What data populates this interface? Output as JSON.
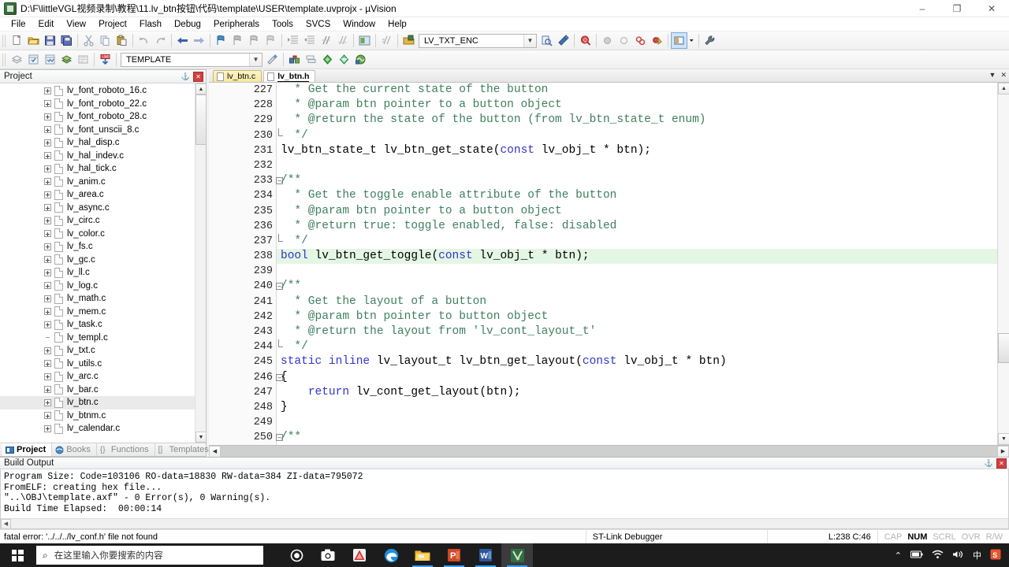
{
  "window": {
    "title": "D:\\F\\littleVGL视频录制\\教程\\11.lv_btn按钮\\代码\\template\\USER\\template.uvprojx - µVision",
    "app_icon": "uvision-icon",
    "minimize": "–",
    "maximize": "❐",
    "close": "✕"
  },
  "menu": [
    "File",
    "Edit",
    "View",
    "Project",
    "Flash",
    "Debug",
    "Peripherals",
    "Tools",
    "SVCS",
    "Window",
    "Help"
  ],
  "toolbar_row1_icons": [
    "new-file-icon",
    "open-file-icon",
    "save-icon",
    "save-all-icon",
    "cut-icon",
    "copy-icon",
    "paste-icon",
    "undo-icon",
    "redo-icon",
    "navigate-back-icon",
    "navigate-forward-icon",
    "bookmark-toggle-icon",
    "bookmark-prev-icon",
    "bookmark-next-icon",
    "bookmark-clear-icon",
    "indent-icon",
    "outdent-icon",
    "comment-icon",
    "uncomment-icon",
    "build-target-icon"
  ],
  "toolbar_row2": {
    "icons_left": [
      "translate-icon",
      "build-icon",
      "rebuild-icon",
      "batch-build-icon",
      "stop-build-icon",
      "download-icon"
    ],
    "target_value": "TEMPLATE",
    "target_placeholder": "TEMPLATE",
    "icons_after_target": [
      "target-options-icon",
      "manage-runtime-icon",
      "project-window-icon",
      "books-window-icon",
      "functions-window-icon",
      "templates-window-icon",
      "multiproject-icon"
    ],
    "second_combo_value": "LV_TXT_ENC",
    "icons_right": [
      "insert-include-icon",
      "configure-icon",
      "find-in-files-icon",
      "breakpoint-icon",
      "breakpoint-disable-icon",
      "kill-breakpoints-icon",
      "disable-breakpoints-icon",
      "window-layout-icon",
      "dropdown-arrow-icon",
      "settings-wrench-icon"
    ]
  },
  "project_panel": {
    "caption": "Project",
    "pin_glyph": "⚓",
    "close_glyph": "✕",
    "tree": [
      {
        "label": "lv_font_roboto_16.c",
        "expandable": true,
        "selected": false
      },
      {
        "label": "lv_font_roboto_22.c",
        "expandable": true,
        "selected": false
      },
      {
        "label": "lv_font_roboto_28.c",
        "expandable": true,
        "selected": false
      },
      {
        "label": "lv_font_unscii_8.c",
        "expandable": true,
        "selected": false
      },
      {
        "label": "lv_hal_disp.c",
        "expandable": true,
        "selected": false
      },
      {
        "label": "lv_hal_indev.c",
        "expandable": true,
        "selected": false
      },
      {
        "label": "lv_hal_tick.c",
        "expandable": true,
        "selected": false
      },
      {
        "label": "lv_anim.c",
        "expandable": true,
        "selected": false
      },
      {
        "label": "lv_area.c",
        "expandable": true,
        "selected": false
      },
      {
        "label": "lv_async.c",
        "expandable": true,
        "selected": false
      },
      {
        "label": "lv_circ.c",
        "expandable": true,
        "selected": false
      },
      {
        "label": "lv_color.c",
        "expandable": true,
        "selected": false
      },
      {
        "label": "lv_fs.c",
        "expandable": true,
        "selected": false
      },
      {
        "label": "lv_gc.c",
        "expandable": true,
        "selected": false
      },
      {
        "label": "lv_ll.c",
        "expandable": true,
        "selected": false
      },
      {
        "label": "lv_log.c",
        "expandable": true,
        "selected": false
      },
      {
        "label": "lv_math.c",
        "expandable": true,
        "selected": false
      },
      {
        "label": "lv_mem.c",
        "expandable": true,
        "selected": false
      },
      {
        "label": "lv_task.c",
        "expandable": true,
        "selected": false
      },
      {
        "label": "lv_templ.c",
        "expandable": false,
        "selected": false
      },
      {
        "label": "lv_txt.c",
        "expandable": true,
        "selected": false
      },
      {
        "label": "lv_utils.c",
        "expandable": true,
        "selected": false
      },
      {
        "label": "lv_arc.c",
        "expandable": true,
        "selected": false
      },
      {
        "label": "lv_bar.c",
        "expandable": true,
        "selected": false
      },
      {
        "label": "lv_btn.c",
        "expandable": true,
        "selected": true
      },
      {
        "label": "lv_btnm.c",
        "expandable": true,
        "selected": false
      },
      {
        "label": "lv_calendar.c",
        "expandable": true,
        "selected": false
      }
    ],
    "tabs": [
      {
        "label": "Project",
        "icon": "project-icon",
        "active": true
      },
      {
        "label": "Books",
        "icon": "books-icon",
        "active": false
      },
      {
        "label": "Functions",
        "icon": "functions-icon",
        "active": false
      },
      {
        "label": "Templates",
        "icon": "templates-icon",
        "active": false
      }
    ]
  },
  "editor": {
    "tabs": [
      {
        "label": "lv_btn.c",
        "active": false
      },
      {
        "label": "lv_btn.h",
        "active": true
      }
    ],
    "tabbar_buttons": [
      "tab-list-dropdown-icon",
      "close-document-icon"
    ],
    "lines": [
      {
        "num": "227",
        "fold": "",
        "text": "  * Get the current state of the button",
        "type": "comment"
      },
      {
        "num": "228",
        "fold": "",
        "text": "  * @param btn pointer to a button object",
        "type": "comment"
      },
      {
        "num": "229",
        "fold": "",
        "text": "  * @return the state of the button (from lv_btn_state_t enum)",
        "type": "comment"
      },
      {
        "num": "230",
        "fold": "end",
        "text": "  */",
        "type": "comment"
      },
      {
        "num": "231",
        "fold": "",
        "text": "lv_btn_state_t lv_btn_get_state(const lv_obj_t * btn);",
        "type": "code",
        "kw": [
          "const"
        ]
      },
      {
        "num": "232",
        "fold": "",
        "text": "",
        "type": "code"
      },
      {
        "num": "233",
        "fold": "minus",
        "text": "/**",
        "type": "comment"
      },
      {
        "num": "234",
        "fold": "",
        "text": "  * Get the toggle enable attribute of the button",
        "type": "comment"
      },
      {
        "num": "235",
        "fold": "",
        "text": "  * @param btn pointer to a button object",
        "type": "comment"
      },
      {
        "num": "236",
        "fold": "",
        "text": "  * @return true: toggle enabled, false: disabled",
        "type": "comment"
      },
      {
        "num": "237",
        "fold": "end",
        "text": "  */",
        "type": "comment"
      },
      {
        "num": "238",
        "fold": "",
        "text": "bool lv_btn_get_toggle(const lv_obj_t * btn);",
        "type": "code",
        "kw": [
          "bool",
          "const"
        ],
        "highlighted": true
      },
      {
        "num": "239",
        "fold": "",
        "text": "",
        "type": "code"
      },
      {
        "num": "240",
        "fold": "minus",
        "text": "/**",
        "type": "comment"
      },
      {
        "num": "241",
        "fold": "",
        "text": "  * Get the layout of a button",
        "type": "comment"
      },
      {
        "num": "242",
        "fold": "",
        "text": "  * @param btn pointer to button object",
        "type": "comment"
      },
      {
        "num": "243",
        "fold": "",
        "text": "  * @return the layout from 'lv_cont_layout_t'",
        "type": "comment"
      },
      {
        "num": "244",
        "fold": "end",
        "text": "  */",
        "type": "comment"
      },
      {
        "num": "245",
        "fold": "",
        "text": "static inline lv_layout_t lv_btn_get_layout(const lv_obj_t * btn)",
        "type": "code",
        "kw": [
          "static",
          "inline",
          "const"
        ]
      },
      {
        "num": "246",
        "fold": "minus",
        "text": "{",
        "type": "code"
      },
      {
        "num": "247",
        "fold": "",
        "text": "    return lv_cont_get_layout(btn);",
        "type": "code",
        "kw": [
          "return"
        ]
      },
      {
        "num": "248",
        "fold": "",
        "text": "}",
        "type": "code"
      },
      {
        "num": "249",
        "fold": "",
        "text": "",
        "type": "code"
      },
      {
        "num": "250",
        "fold": "minus",
        "text": "/**",
        "type": "comment"
      }
    ]
  },
  "build_output": {
    "caption": "Build Output",
    "pin_glyph": "⚓",
    "close_glyph": "✕",
    "lines": [
      "Program Size: Code=103106 RO-data=18830 RW-data=384 ZI-data=795072",
      "FromELF: creating hex file...",
      "\"..\\OBJ\\template.axf\" - 0 Error(s), 0 Warning(s).",
      "Build Time Elapsed:  00:00:14"
    ]
  },
  "status_bar": {
    "message": "fatal error: '../../../lv_conf.h' file not found",
    "debugger": "ST-Link Debugger",
    "cursor_pos": "L:238 C:46",
    "flags": [
      {
        "label": "CAP",
        "on": false
      },
      {
        "label": "NUM",
        "on": true
      },
      {
        "label": "SCRL",
        "on": false
      },
      {
        "label": "OVR",
        "on": false
      },
      {
        "label": "R/W",
        "on": false
      }
    ]
  },
  "taskbar": {
    "start_icon": "windows-start-icon",
    "search_placeholder": "在这里输入你要搜索的内容",
    "search_icon": "search-icon",
    "apps": [
      {
        "name": "cortana-icon",
        "running": false,
        "active": false
      },
      {
        "name": "camera-icon",
        "running": false,
        "active": false
      },
      {
        "name": "pdf-reader-icon",
        "running": false,
        "active": false
      },
      {
        "name": "edge-browser-icon",
        "running": false,
        "active": false
      },
      {
        "name": "file-explorer-icon",
        "running": true,
        "active": false
      },
      {
        "name": "powerpoint-icon",
        "running": true,
        "active": false
      },
      {
        "name": "word-icon",
        "running": true,
        "active": false
      },
      {
        "name": "keil-uvision-icon",
        "running": true,
        "active": true
      }
    ],
    "tray": [
      {
        "name": "show-hidden-icons-icon",
        "glyph": "⌃"
      },
      {
        "name": "battery-icon",
        "glyph": "▬"
      },
      {
        "name": "wifi-icon",
        "glyph": "◠"
      },
      {
        "name": "volume-icon",
        "glyph": "◂)"
      },
      {
        "name": "ime-chinese-icon",
        "glyph": "中"
      },
      {
        "name": "sogou-input-icon",
        "glyph": "S"
      }
    ]
  },
  "colors": {
    "comment": "#3f7f5f",
    "keyword": "#3333cc",
    "highlight_line": "#e4f6e4",
    "tab_active": "#ffffff",
    "tab_inactive": "#f7e89f",
    "taskbar": "#1c1c1c"
  }
}
